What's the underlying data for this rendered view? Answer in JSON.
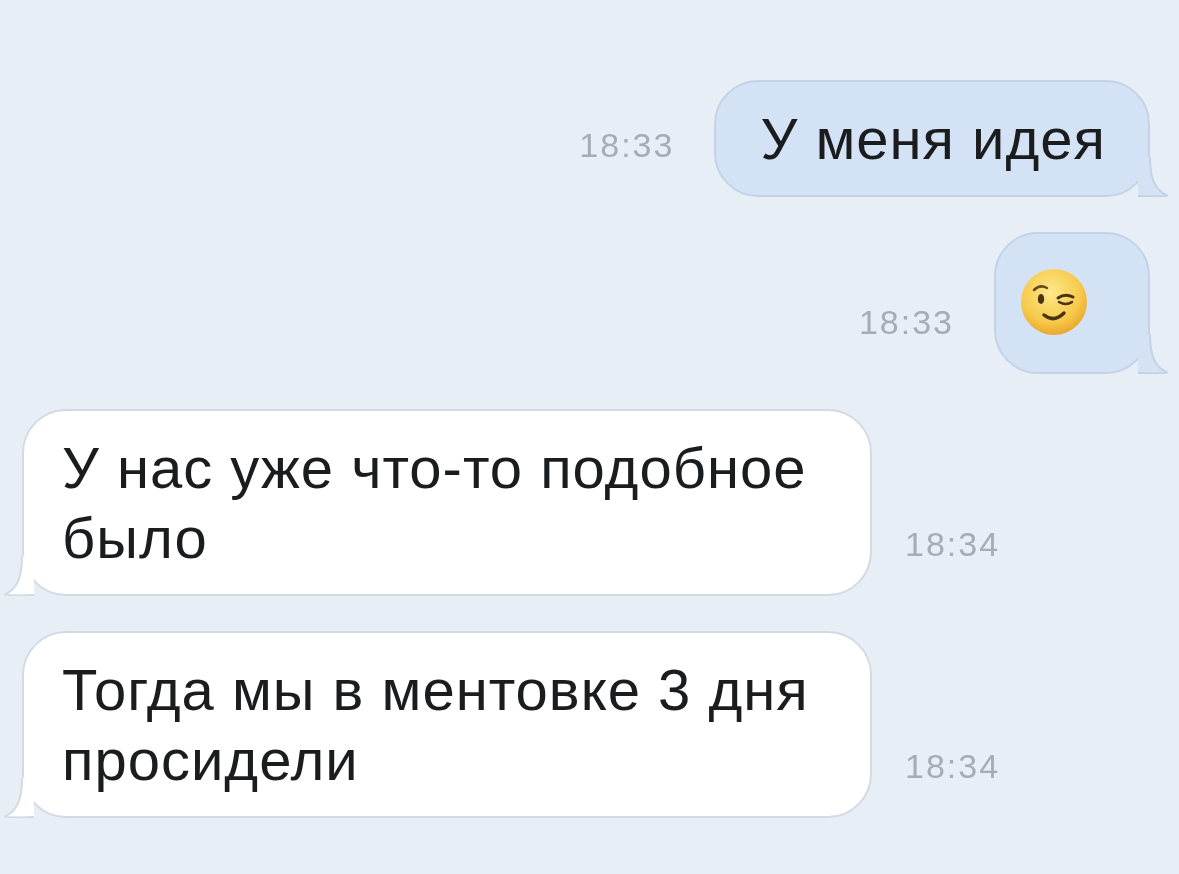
{
  "messages": [
    {
      "outgoing": true,
      "kind": "text",
      "text": "У меня идея",
      "time": "18:33"
    },
    {
      "outgoing": true,
      "kind": "emoji",
      "time": "18:33"
    },
    {
      "outgoing": false,
      "kind": "text",
      "text": "У нас уже что-то подобное было",
      "time": "18:34"
    },
    {
      "outgoing": false,
      "kind": "text",
      "text": "Тогда мы в ментовке 3 дня просидели",
      "time": "18:34"
    }
  ]
}
